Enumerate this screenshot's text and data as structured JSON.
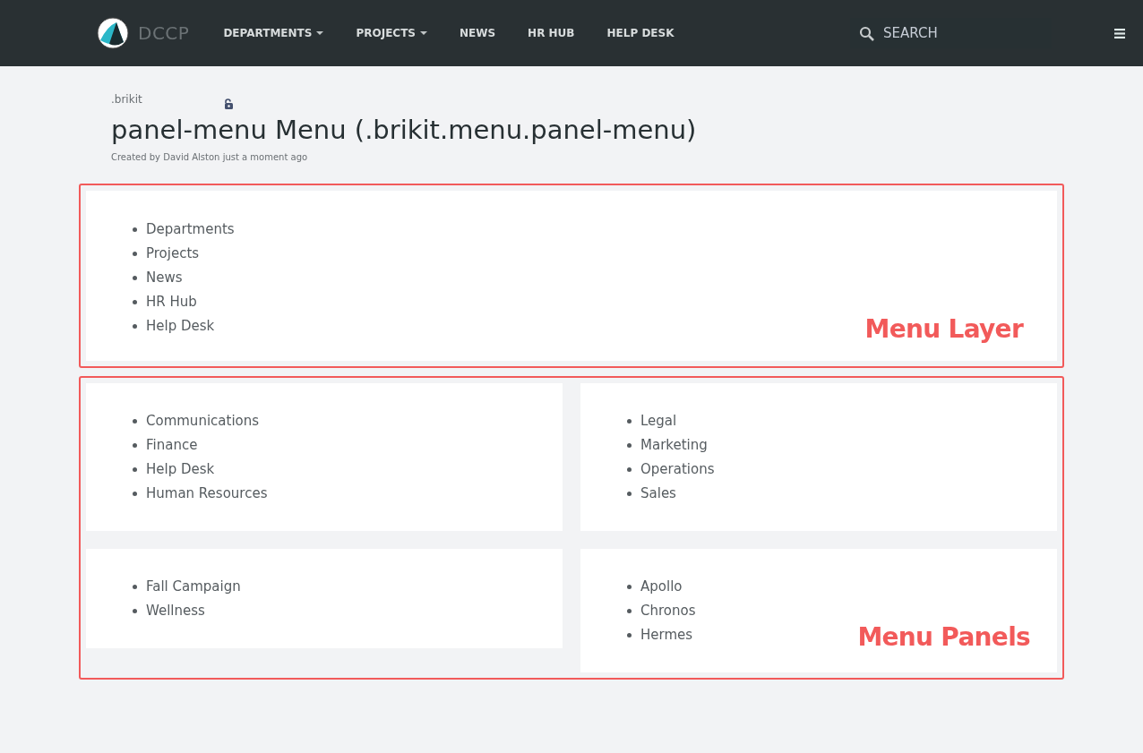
{
  "header": {
    "logo_text": "DCCP",
    "nav": [
      {
        "label": "DEPARTMENTS",
        "has_dropdown": true
      },
      {
        "label": "PROJECTS",
        "has_dropdown": true
      },
      {
        "label": "NEWS",
        "has_dropdown": false
      },
      {
        "label": "HR HUB",
        "has_dropdown": false
      },
      {
        "label": "HELP DESK",
        "has_dropdown": false
      }
    ],
    "search": {
      "placeholder": "SEARCH"
    }
  },
  "page": {
    "space": ".brikit",
    "title": "panel-menu Menu (.brikit.menu.panel-menu)",
    "byline": "Created by David Alston just a moment ago"
  },
  "menu_layer": {
    "annotation": "Menu Layer",
    "items": [
      "Departments",
      "Projects",
      "News",
      "HR Hub",
      "Help Desk"
    ]
  },
  "menu_panels": {
    "annotation": "Menu Panels",
    "panels": [
      {
        "items": [
          "Communications",
          "Finance",
          "Help Desk",
          "Human Resources"
        ]
      },
      {
        "items": [
          "Legal",
          "Marketing",
          "Operations",
          "Sales"
        ]
      },
      {
        "items": [
          "Fall Campaign",
          "Wellness"
        ]
      },
      {
        "items": [
          "Apollo",
          "Chronos",
          "Hermes"
        ]
      }
    ]
  }
}
